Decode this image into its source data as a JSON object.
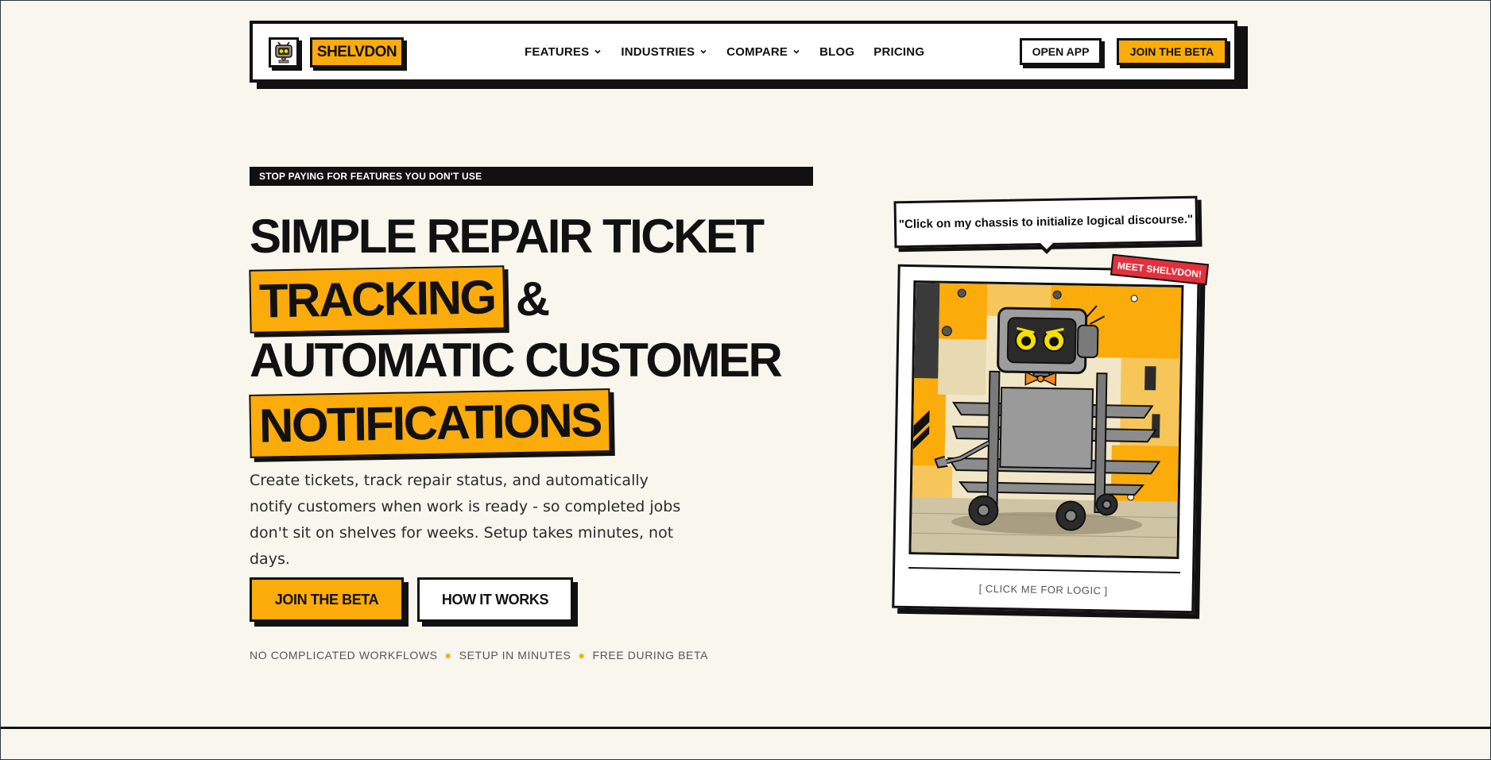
{
  "nav": {
    "brand": "SHELVDON",
    "menu": [
      {
        "label": "FEATURES",
        "dropdown": true
      },
      {
        "label": "INDUSTRIES",
        "dropdown": true
      },
      {
        "label": "COMPARE",
        "dropdown": true
      },
      {
        "label": "BLOG",
        "dropdown": false
      },
      {
        "label": "PRICING",
        "dropdown": false
      }
    ],
    "open_app": "OPEN APP",
    "join_beta": "JOIN THE BETA"
  },
  "hero": {
    "eyebrow": "STOP PAYING FOR FEATURES YOU DON'T USE",
    "headline": {
      "line1": "SIMPLE REPAIR TICKET",
      "highlight1": "TRACKING",
      "amp": "&",
      "line3": "AUTOMATIC CUSTOMER",
      "highlight2": "NOTIFICATIONS"
    },
    "subcopy": "Create tickets, track repair status, and automatically notify customers when work is ready - so completed jobs don't sit on shelves for weeks. Setup takes minutes, not days.",
    "cta_primary": "JOIN THE BETA",
    "cta_secondary": "HOW IT WORKS",
    "perks": [
      "NO COMPLICATED WORKFLOWS",
      "SETUP IN MINUTES",
      "FREE DURING BETA"
    ]
  },
  "mascot": {
    "speech": "\"Click on my chassis to initialize logical discourse.\"",
    "tag": "MEET SHELVDON!",
    "caption": "[ CLICK ME FOR LOGIC ]"
  },
  "colors": {
    "accent": "#fbab0a",
    "ink": "#111111",
    "background": "#f9f6ee",
    "tag_red": "#e2303d"
  }
}
